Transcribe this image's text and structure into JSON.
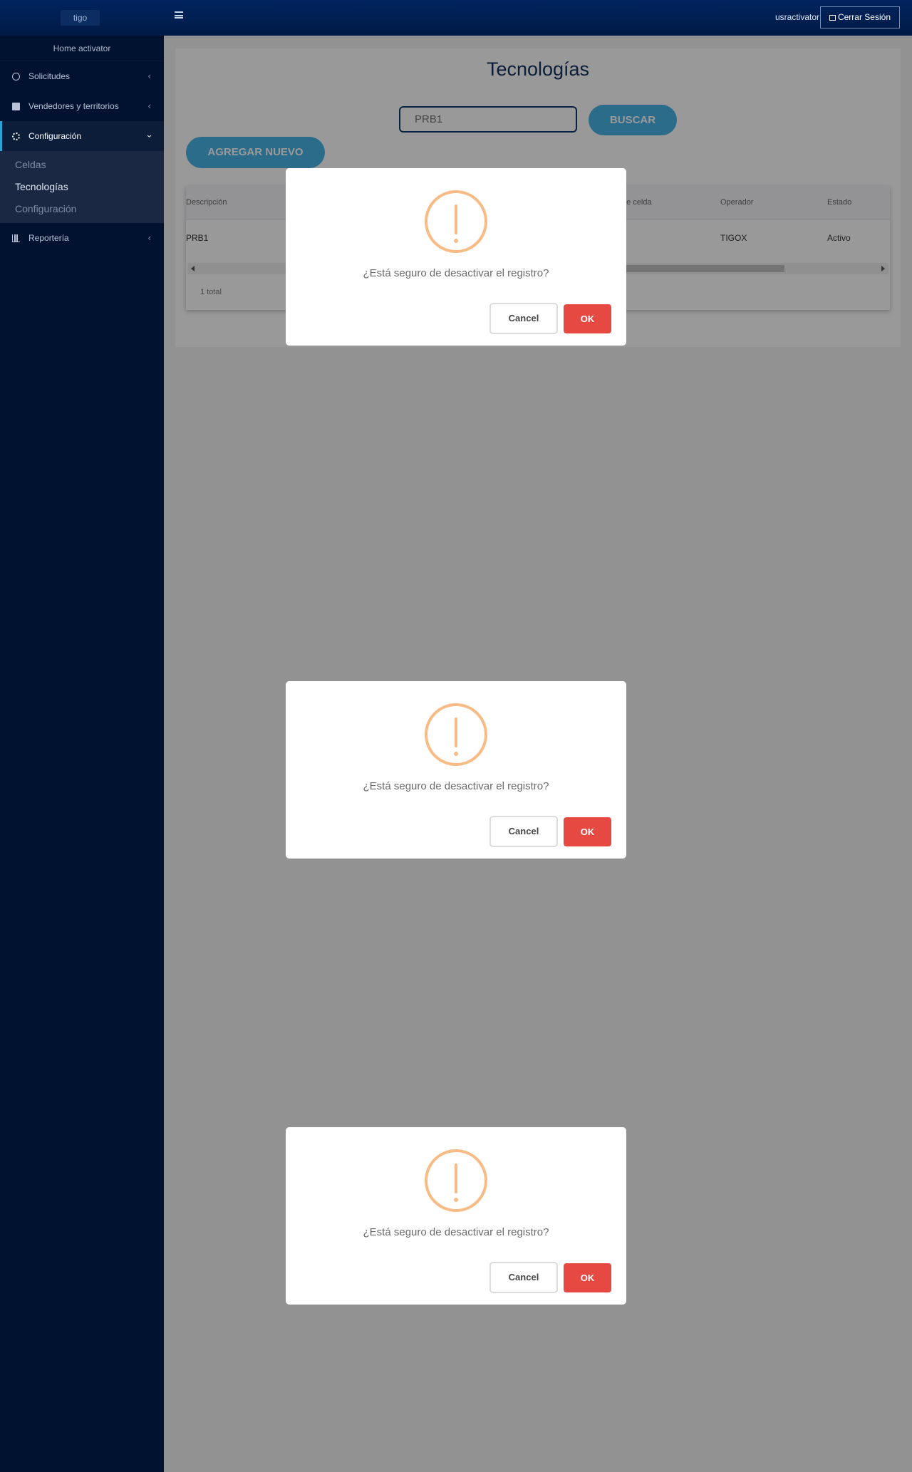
{
  "topbar": {
    "logo": "tigo",
    "username": "usractivator",
    "logout_label": "Cerrar Sesión"
  },
  "sidebar": {
    "title": "Home activator",
    "items": [
      {
        "label": "Solicitudes",
        "icon": "circle-icon"
      },
      {
        "label": "Vendedores y territorios",
        "icon": "contact-icon"
      },
      {
        "label": "Configuración",
        "icon": "gears-icon"
      },
      {
        "label": "Reportería",
        "icon": "chart-icon"
      }
    ],
    "submenu": [
      "Celdas",
      "Tecnologías",
      "Configuración"
    ],
    "chevron_left": "‹",
    "chevron_down": "›"
  },
  "main": {
    "title": "Tecnologías",
    "search_value": "PRB1",
    "search_button": "BUSCAR",
    "add_button": "AGREGAR NUEVO",
    "table": {
      "headers": [
        "Descripción",
        "ne celda",
        "Operador",
        "Estado"
      ],
      "rows": [
        {
          "descripcion": "PRB1",
          "operador": "TIGOX",
          "estado": "Activo"
        }
      ],
      "total": "1 total"
    }
  },
  "dialog": {
    "message": "¿Está seguro de desactivar el registro?",
    "cancel": "Cancel",
    "ok": "OK"
  },
  "colors": {
    "topbar": "#00245f",
    "sidebar": "#001230",
    "accent": "#49b5e6",
    "warning": "#f8bb86",
    "danger": "#e64942"
  }
}
